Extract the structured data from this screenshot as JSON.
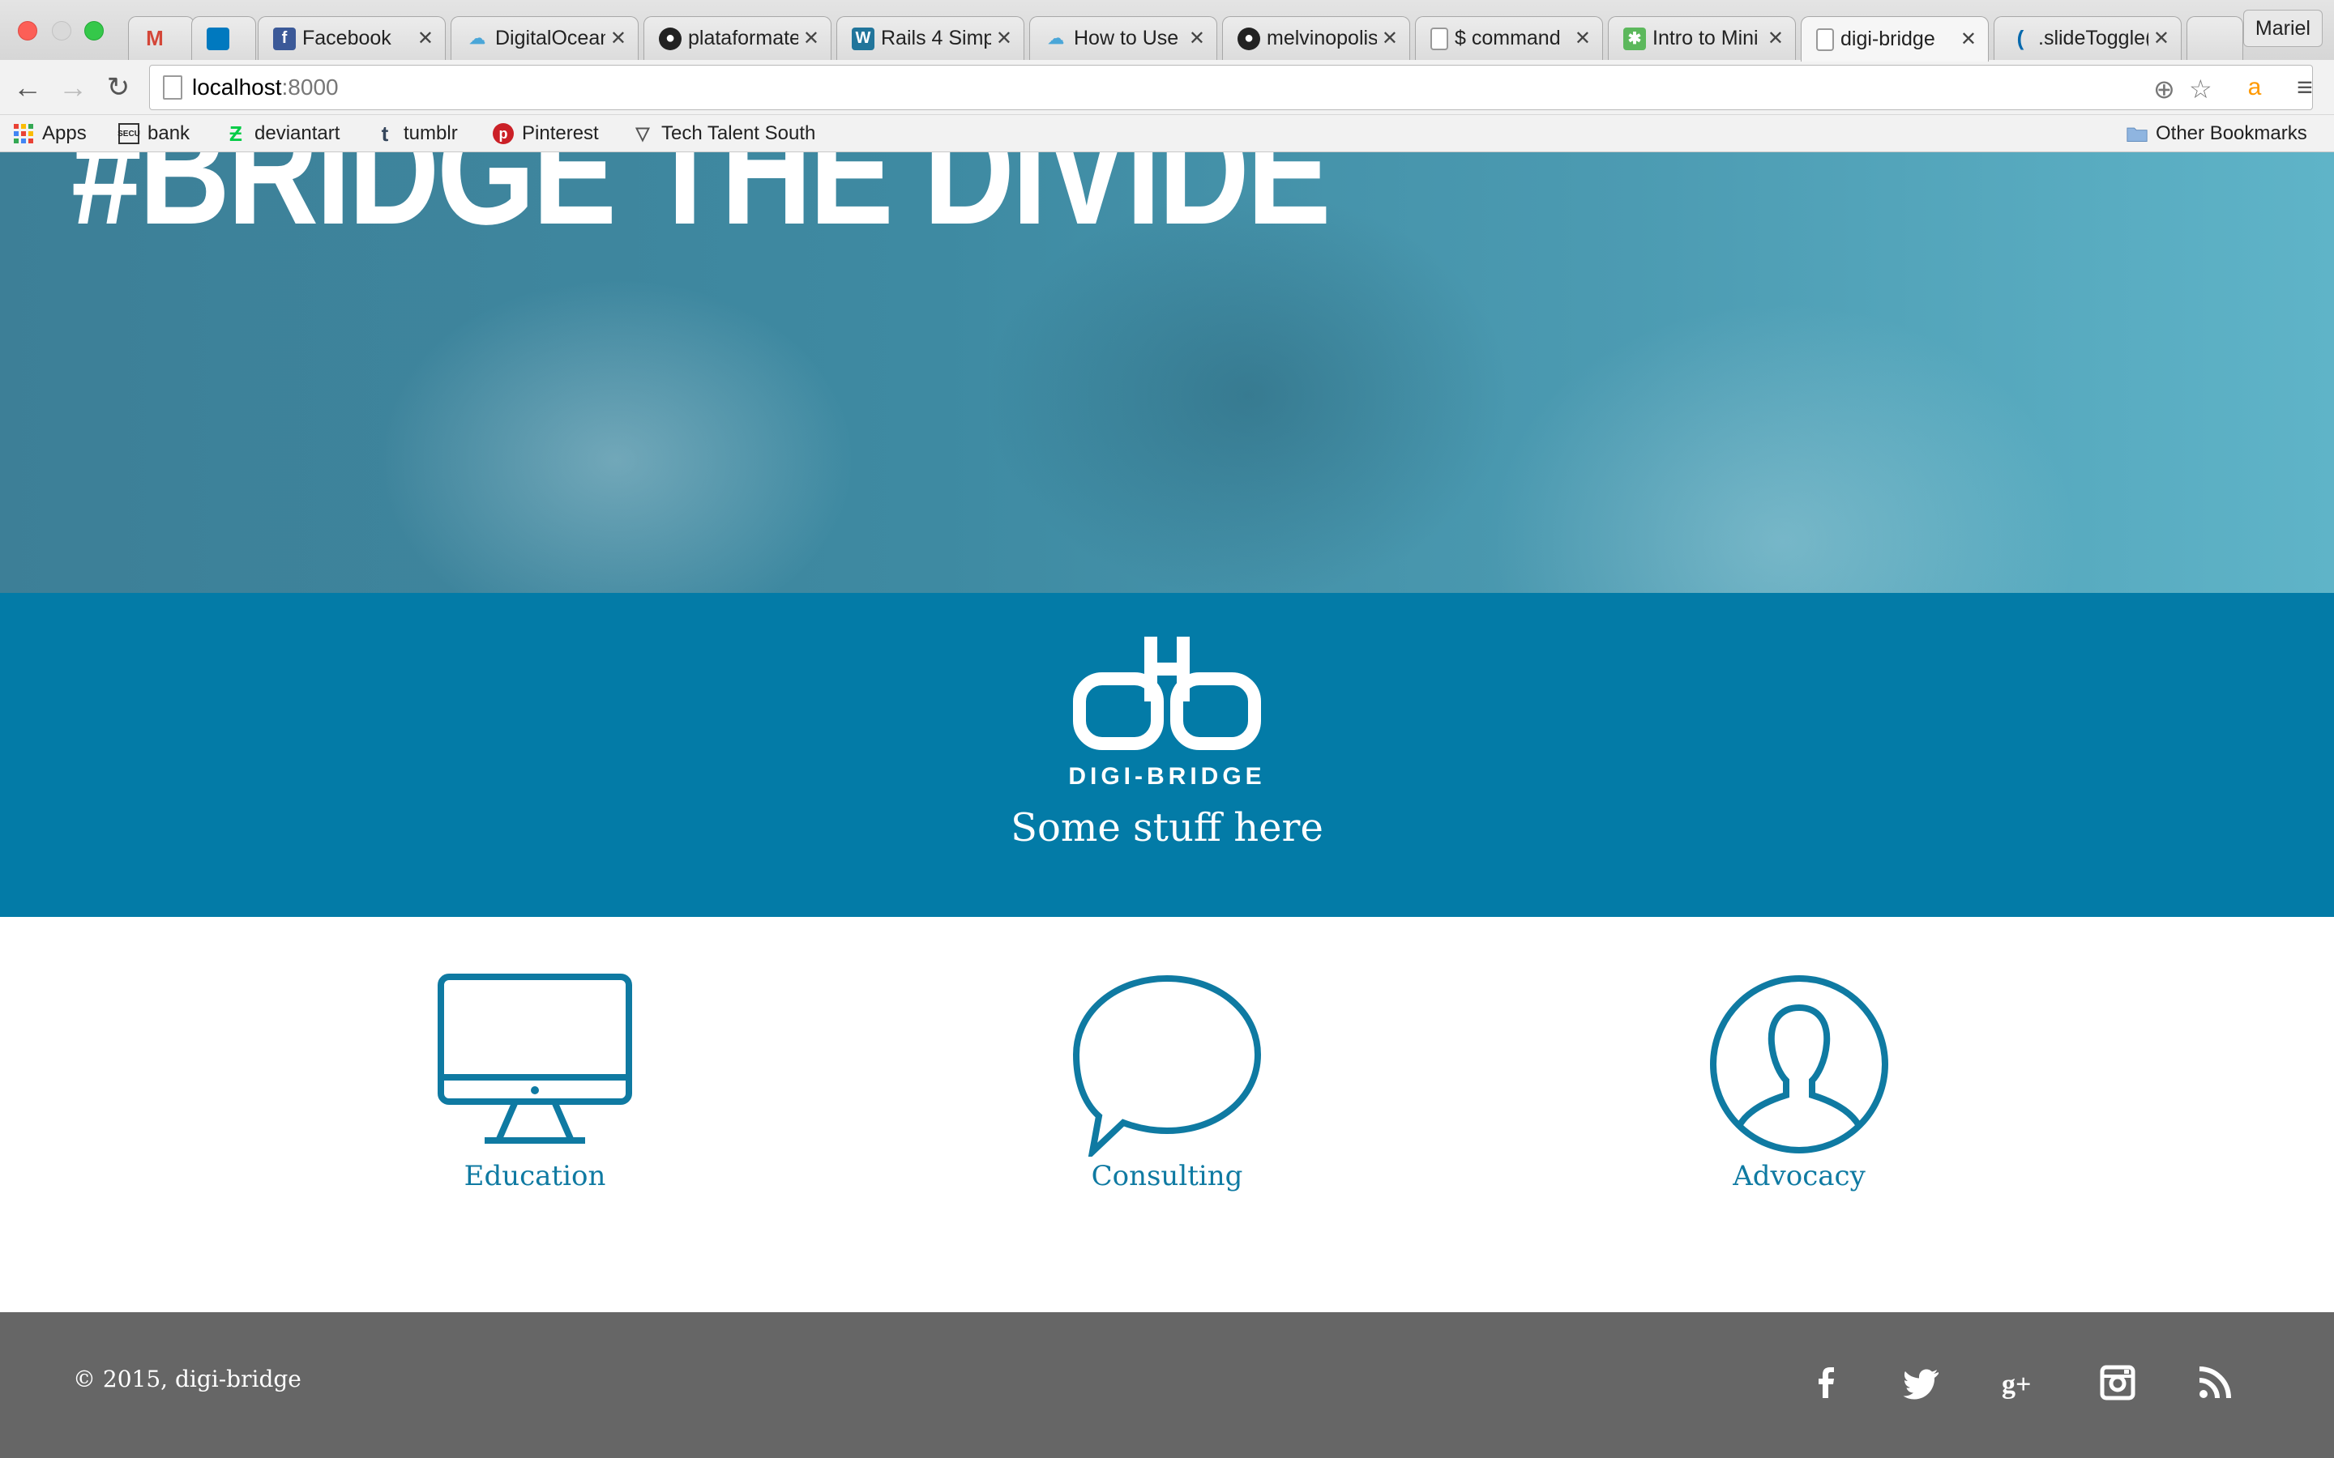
{
  "browser": {
    "tabs": [
      {
        "title": "",
        "favicon": "gmail-icon",
        "color": "#d44638"
      },
      {
        "title": "",
        "favicon": "trello-icon",
        "color": "#0079bf"
      },
      {
        "title": "Facebook",
        "favicon": "facebook-icon",
        "color": "#3b5998"
      },
      {
        "title": "DigitalOcean",
        "favicon": "cloud-icon",
        "color": "#4aa6d8"
      },
      {
        "title": "plataformate",
        "favicon": "github-icon",
        "color": "#222222"
      },
      {
        "title": "Rails 4 Simp",
        "favicon": "wordpress-icon",
        "color": "#21759b"
      },
      {
        "title": "How to Use",
        "favicon": "cloud-icon",
        "color": "#4aa6d8"
      },
      {
        "title": "melvinopolis",
        "favicon": "github-icon",
        "color": "#222222"
      },
      {
        "title": "$ command",
        "favicon": "page-icon",
        "color": "#ffffff"
      },
      {
        "title": "Intro to Mini",
        "favicon": "puzzle-icon",
        "color": "#5cb85c"
      },
      {
        "title": "digi-bridge",
        "favicon": "page-icon",
        "color": "#ffffff"
      },
      {
        "title": ".slideToggle(",
        "favicon": "jquery-icon",
        "color": "#0769ad"
      }
    ],
    "user_label": "Mariel",
    "url_host": "localhost",
    "url_port": ":8000",
    "bookmarks": [
      {
        "label": "Apps",
        "icon": "apps-grid-icon"
      },
      {
        "label": "bank",
        "icon": "bank-icon"
      },
      {
        "label": "deviantart",
        "icon": "deviantart-icon"
      },
      {
        "label": "tumblr",
        "icon": "tumblr-icon"
      },
      {
        "label": "Pinterest",
        "icon": "pinterest-icon"
      },
      {
        "label": "Tech Talent South",
        "icon": "triangle-icon"
      }
    ],
    "other_bookmarks": "Other Bookmarks"
  },
  "hero": {
    "title": "#BRIDGE THE DIVIDE"
  },
  "brand": {
    "name": "DIGI-BRIDGE",
    "tagline": "Some stuff here",
    "color": "#037ba7"
  },
  "services": [
    {
      "label": "Education",
      "icon": "desktop-computer-icon"
    },
    {
      "label": "Consulting",
      "icon": "speech-bubble-icon"
    },
    {
      "label": "Advocacy",
      "icon": "user-profile-icon"
    }
  ],
  "footer": {
    "copyright": "© 2015, digi-bridge",
    "social": [
      "facebook-icon",
      "twitter-icon",
      "google-plus-icon",
      "instagram-icon",
      "rss-icon"
    ],
    "background": "#666666"
  }
}
